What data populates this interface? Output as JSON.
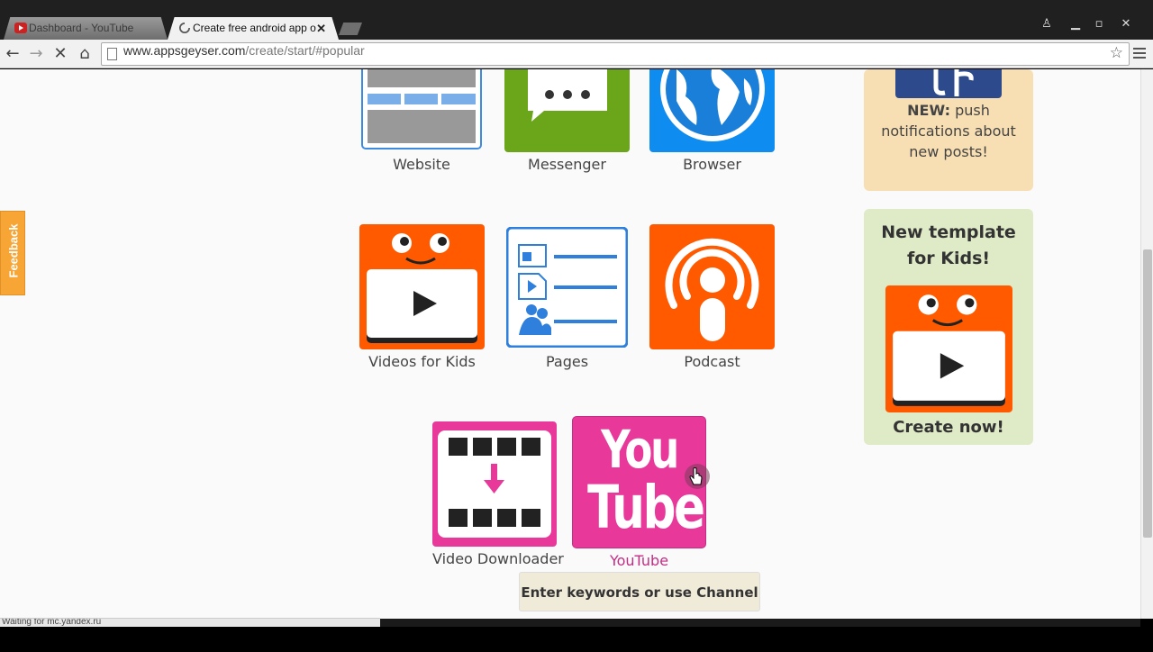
{
  "browser": {
    "tabs": [
      {
        "label": "Dashboard - YouTube",
        "active": false
      },
      {
        "label": "Create free android app o",
        "active": true
      }
    ],
    "url_host": "www.appsgeyser.com",
    "url_path": "/create/start/#popular",
    "status_text": "Waiting for mc.yandex.ru"
  },
  "sidebar": {
    "feedback_label": "Feedback"
  },
  "tiles": {
    "website": "Website",
    "messenger": "Messenger",
    "browser": "Browser",
    "videos_for_kids": "Videos for Kids",
    "pages": "Pages",
    "podcast": "Podcast",
    "video_downloader": "Video Downloader",
    "youtube": "YouTube",
    "youtube_logo_top": "You",
    "youtube_logo_bottom": "Tube"
  },
  "promos": {
    "push_bold": "NEW:",
    "push_text_1": "push",
    "push_text_2": "notifications about",
    "push_text_3": "new posts!",
    "kids_head_1": "New template",
    "kids_head_2": "for Kids!",
    "kids_cta": "Create now!"
  },
  "youtube_hint": "Enter keywords or use Channel url",
  "colors": {
    "orange": "#ff5a00",
    "green": "#6aa51a",
    "blue": "#0e8cf0",
    "pink": "#e8399b",
    "promo_peach": "#f8dfb3",
    "promo_green": "#dfeac6"
  }
}
